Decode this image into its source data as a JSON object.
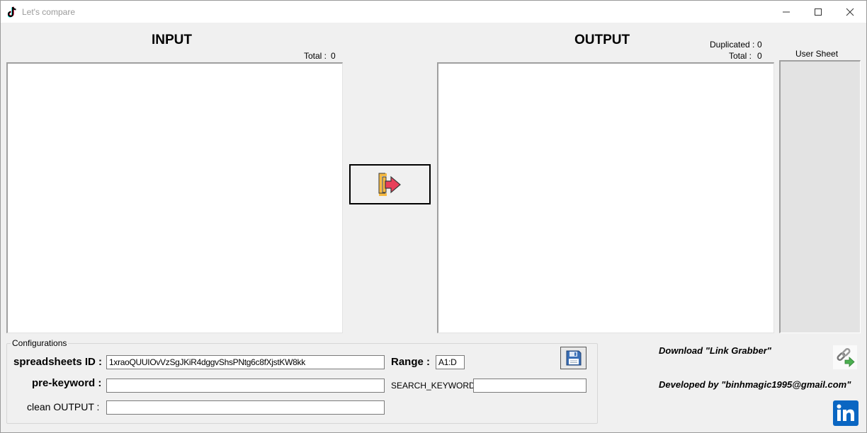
{
  "window": {
    "title": "Let's compare"
  },
  "input_panel": {
    "heading": "INPUT",
    "total_label": "Total :",
    "total_value": "0",
    "text": ""
  },
  "output_panel": {
    "heading": "OUTPUT",
    "duplicated_label": "Duplicated :",
    "duplicated_value": "0",
    "total_label": "Total :",
    "total_value": "0",
    "text": ""
  },
  "user_sheet": {
    "label": "User Sheet"
  },
  "configurations": {
    "group_label": "Configurations",
    "spreadsheets_id_label": "spreadsheets ID :",
    "spreadsheets_id_value": "1xraoQUUIOvVzSgJKiR4dggvShsPNtg6c8fXjstKW8kk",
    "range_label": "Range :",
    "range_value": "A1:D",
    "pre_keyword_label": "pre-keyword :",
    "pre_keyword_value": "",
    "search_keyword_label": "SEARCH_KEYWORD",
    "search_keyword_value": "",
    "clean_output_label": "clean OUTPUT :",
    "clean_output_value": ""
  },
  "footer": {
    "download_text": "Download \"Link Grabber\"",
    "developed_text": "Developed by \"binhmagic1995@gmail.com\""
  },
  "icons": {
    "app": "tiktok-icon",
    "transfer": "transfer-arrow-icon",
    "save": "floppy-disk-icon",
    "link_grabber": "link-grabber-icon",
    "linkedin": "linkedin-icon"
  },
  "colors": {
    "arrow_red": "#e8405a",
    "bracket_orange": "#f5b942",
    "linkedin_blue": "#0a66c2",
    "floppy_blue": "#3a6fb6"
  }
}
